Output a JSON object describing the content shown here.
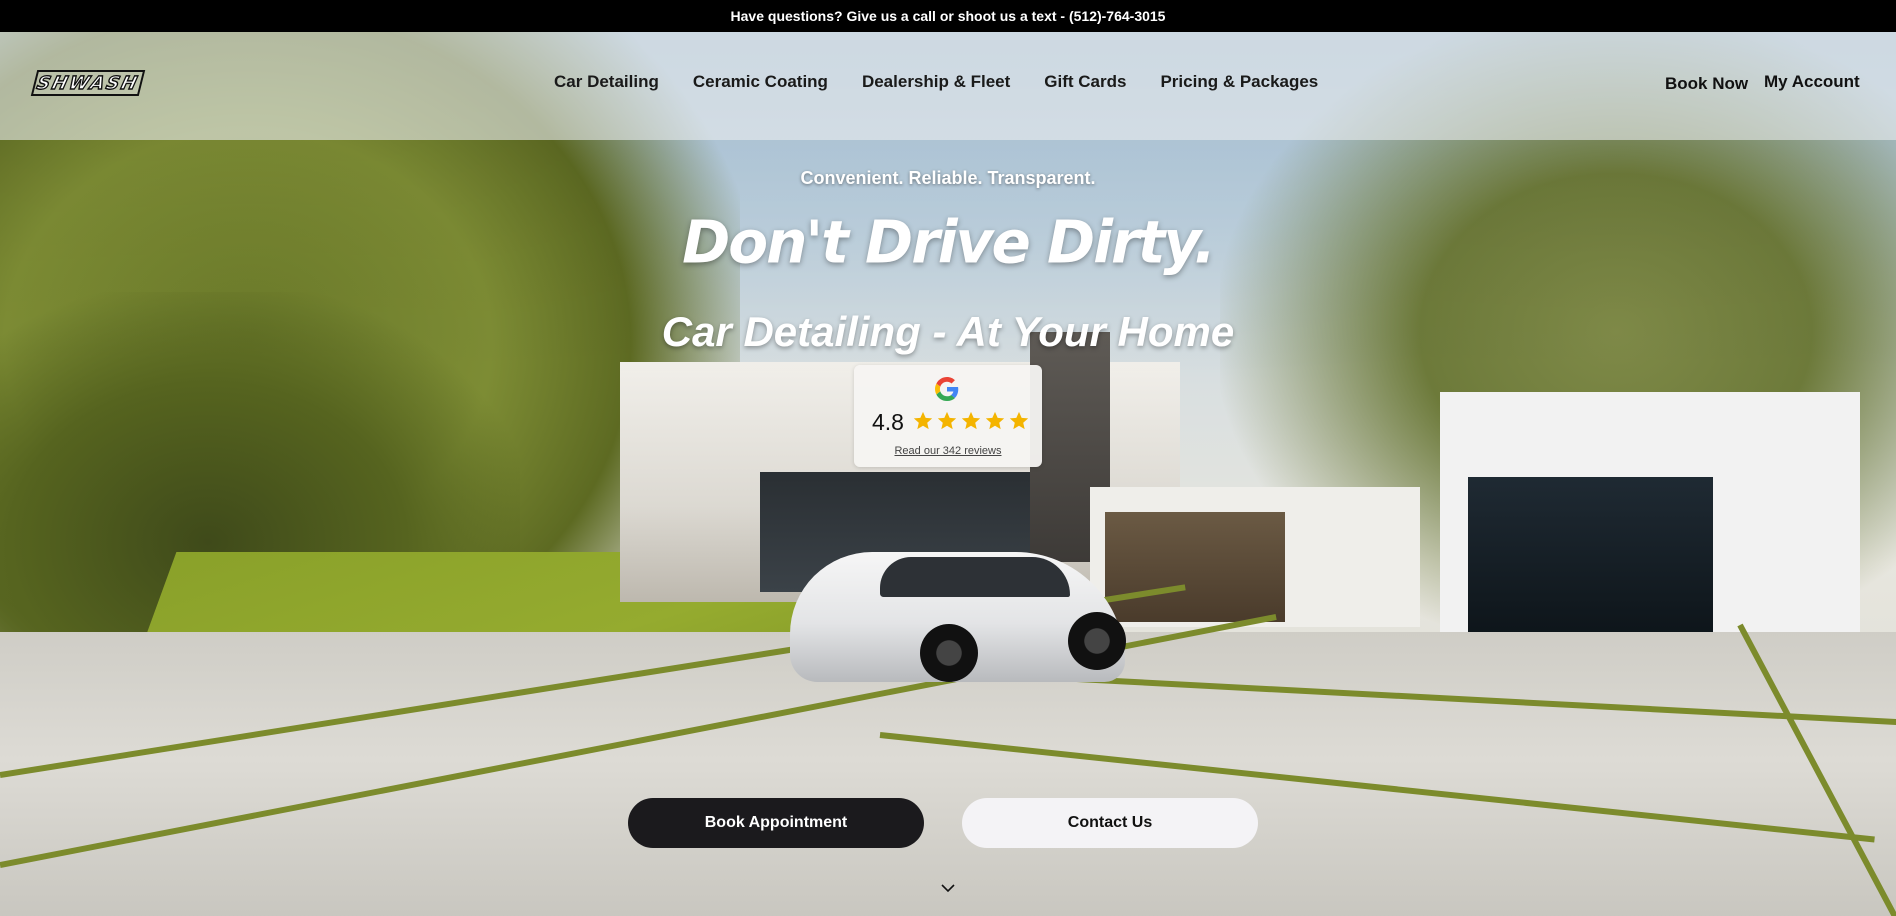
{
  "topbar": {
    "text": "Have questions? Give us a call or shoot us a text - (512)-764-3015"
  },
  "header": {
    "logo_text": "SHWASH",
    "nav": [
      {
        "label": "Car Detailing"
      },
      {
        "label": "Ceramic Coating"
      },
      {
        "label": "Dealership & Fleet"
      },
      {
        "label": "Gift Cards"
      },
      {
        "label": "Pricing & Packages"
      }
    ],
    "book_now": "Book Now",
    "my_account": "My Account"
  },
  "hero": {
    "tagline": "Convenient. Reliable. Transparent.",
    "headline": "Don't Drive Dirty.",
    "subhead": "Car Detailing - At Your Home",
    "review": {
      "rating": "4.8",
      "stars": 5,
      "link": "Read our 342 reviews"
    },
    "buttons": {
      "book": "Book Appointment",
      "contact": "Contact Us"
    }
  },
  "icons": {
    "google": "google-g-icon",
    "star": "star-icon",
    "chevron": "chevron-down-icon"
  },
  "colors": {
    "topbar_bg": "#000000",
    "star": "#f4b400",
    "button_dark": "#1b1a1d",
    "button_light": "#f4f3f6"
  }
}
